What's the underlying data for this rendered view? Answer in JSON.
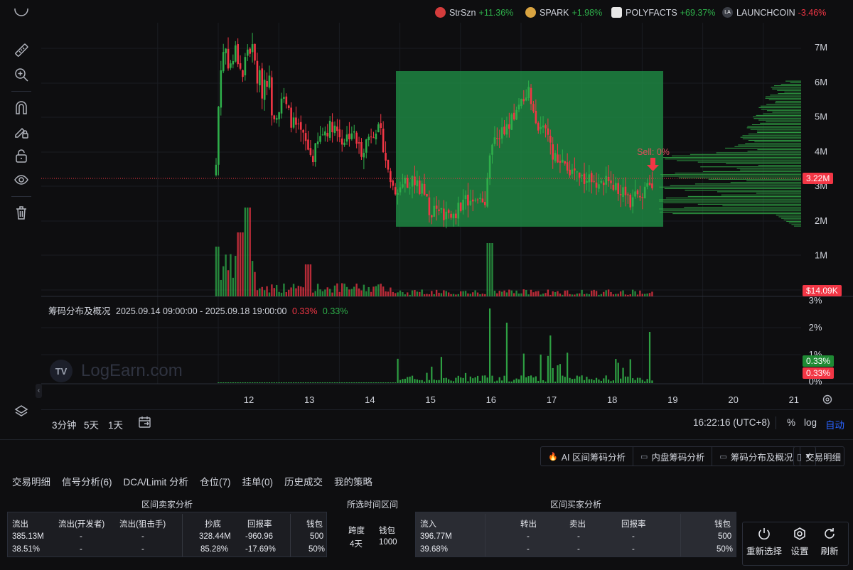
{
  "ticker": [
    {
      "name": "StrSzn",
      "change": "+11.36%",
      "dir": "up",
      "icon_color": "#d43c3c"
    },
    {
      "name": "SPARK",
      "change": "+1.98%",
      "dir": "up",
      "icon_color": "#d9a441"
    },
    {
      "name": "POLYFACTS",
      "change": "+69.37%",
      "dir": "up",
      "icon_color": "#e8e8e8"
    },
    {
      "name": "LAUNCHCOIN",
      "change": "-3.46%",
      "dir": "dn",
      "icon_color": "#444"
    }
  ],
  "toolbar": {
    "icons": [
      "ruler-icon",
      "zoom-in-icon",
      "magnet-icon",
      "pencil-lock-icon",
      "unlock-icon",
      "eye-icon",
      "trash-icon",
      "layers-icon"
    ]
  },
  "chart": {
    "y_axis_labels": [
      "7M",
      "6M",
      "5M",
      "4M",
      "3M",
      "2M",
      "1M"
    ],
    "price_tag": "3.22M",
    "volume_tag": "$14.09K",
    "sell_label": "Sell: 0%",
    "x_axis_labels": [
      "12",
      "13",
      "14",
      "15",
      "16",
      "17",
      "18",
      "19",
      "20",
      "21"
    ],
    "ind_y_labels": [
      "3%",
      "2%",
      "1%",
      "0%"
    ],
    "tag_green": "0.33%",
    "tag_red": "0.33%",
    "watermark": "LogEarn.com",
    "watermark_logo": "TV"
  },
  "chart_data": {
    "type": "candlestick",
    "y_unit": "M (market cap)",
    "ylim": [
      0,
      7.5
    ],
    "x_ticks": [
      "12",
      "13",
      "14",
      "15",
      "16",
      "17",
      "18",
      "19",
      "20",
      "21"
    ],
    "last_price": "3.22M",
    "highlight_range": {
      "x_from": 14.42,
      "x_to": 18.83,
      "y_from": 1.9,
      "y_to": 6.3
    },
    "indicator": {
      "title": "筹码分布及概况",
      "range": "2025.09.14 09:00:00 - 2025.09.18 19:00:00",
      "red_value": "0.33%",
      "green_value": "0.33%",
      "ylim": [
        0,
        3
      ]
    }
  },
  "indicator_legend": {
    "title": "筹码分布及概况",
    "range": "2025.09.14 09:00:00 - 2025.09.18 19:00:00",
    "red_value": "0.33%",
    "green_value": "0.33%"
  },
  "bottombar": {
    "intervals": [
      "3分钟",
      "5天",
      "1天"
    ],
    "time": "16:22:16 (UTC+8)",
    "percent": "%",
    "log": "log",
    "auto": "自动"
  },
  "actions": {
    "ai": "AI 区间筹码分析",
    "inner": "内盘筹码分析",
    "dist": "筹码分布及概况",
    "detail": "交易明细"
  },
  "tabs": [
    "交易明细",
    "信号分析(6)",
    "DCA/Limit 分析",
    "仓位(7)",
    "挂单(0)",
    "历史成交",
    "我的策略"
  ],
  "sell_panel": {
    "title": "区间卖家分析",
    "headers": [
      "流出",
      "流出(开发者)",
      "流出(狙击手)",
      "抄底",
      "回报率",
      "钱包"
    ],
    "row1": [
      "385.13M",
      "-",
      "-",
      "328.44M",
      "-960.96",
      "500"
    ],
    "row2": [
      "38.51%",
      "-",
      "-",
      "85.28%",
      "-17.69%",
      "50%"
    ]
  },
  "time_panel": {
    "title": "所选时间区间",
    "headers": [
      "跨度",
      "钱包"
    ],
    "values": [
      "4天",
      "1000"
    ]
  },
  "buy_panel": {
    "title": "区间买家分析",
    "headers": [
      "流入",
      "转出",
      "卖出",
      "回报率",
      "钱包"
    ],
    "row1": [
      "396.77M",
      "-",
      "-",
      "-",
      "500"
    ],
    "row2": [
      "39.68%",
      "-",
      "-",
      "-",
      "50%"
    ]
  },
  "controls": [
    "重新选择",
    "设置",
    "刷新"
  ],
  "colors": {
    "up": "#2eae4a",
    "down": "#f23645",
    "zone": "#1f8a44",
    "accent_blue": "#2962ff"
  }
}
